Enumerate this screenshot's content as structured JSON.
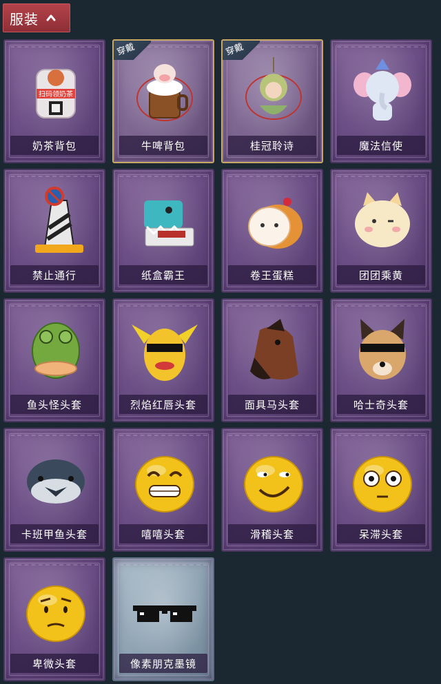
{
  "header": {
    "title": "服装",
    "icon": "chevron-up-icon"
  },
  "items": [
    {
      "label": "奶茶背包",
      "art": "milk-tea-backpack-icon",
      "sign_text": "扫码领奶茶"
    },
    {
      "label": "牛啤背包",
      "art": "cow-beer-backpack-icon",
      "badge": "穿戴"
    },
    {
      "label": "桂冠聆诗",
      "art": "laurel-poet-pendant-icon",
      "badge": "穿戴"
    },
    {
      "label": "魔法信使",
      "art": "magic-elephant-icon"
    },
    {
      "label": "禁止通行",
      "art": "no-entry-cone-icon"
    },
    {
      "label": "纸盒霸王",
      "art": "cardboard-dino-icon"
    },
    {
      "label": "卷王蛋糕",
      "art": "roll-cake-icon"
    },
    {
      "label": "团团乘黄",
      "art": "chubby-cat-icon"
    },
    {
      "label": "鱼头怪头套",
      "art": "fish-head-mask-icon"
    },
    {
      "label": "烈焰红唇头套",
      "art": "pikachu-lips-mask-icon"
    },
    {
      "label": "面具马头套",
      "art": "horse-head-mask-icon"
    },
    {
      "label": "哈士奇头套",
      "art": "husky-mask-icon"
    },
    {
      "label": "卡班甲鱼头套",
      "art": "round-fish-mask-icon"
    },
    {
      "label": "嘻嘻头套",
      "art": "grin-emoji-mask-icon"
    },
    {
      "label": "滑稽头套",
      "art": "smirk-emoji-mask-icon"
    },
    {
      "label": "呆滞头套",
      "art": "dazed-emoji-mask-icon"
    },
    {
      "label": "卑微头套",
      "art": "humble-emoji-mask-icon"
    },
    {
      "label": "像素朋克墨镜",
      "art": "pixel-sunglasses-icon",
      "variant": "alt"
    }
  ]
}
